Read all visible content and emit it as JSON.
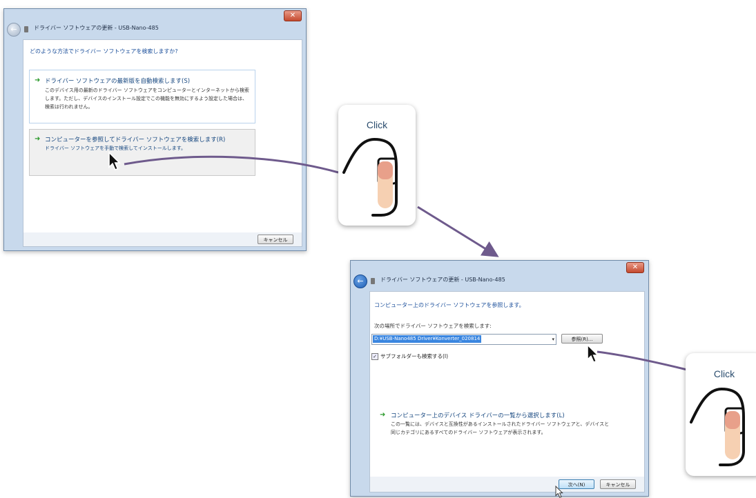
{
  "dialog1": {
    "title": "ドライバー ソフトウェアの更新 - USB-Nano-485",
    "heading": "どのような方法でドライバー ソフトウェアを検索しますか?",
    "option_auto": {
      "title": "ドライバー ソフトウェアの最新版を自動検索します(S)",
      "description": "このデバイス用の最新のドライバー ソフトウェアをコンピューターとインターネットから検索します。ただし、デバイスのインストール設定でこの機能を無効にするよう設定した場合は、検索は行われません。"
    },
    "option_browse": {
      "title": "コンピューターを参照してドライバー ソフトウェアを検索します(R)",
      "description": "ドライバー ソフトウェアを手動で検索してインストールします。"
    },
    "cancel_label": "キャンセル"
  },
  "dialog2": {
    "title": "ドライバー ソフトウェアの更新 - USB-Nano-485",
    "heading": "コンピューター上のドライバー ソフトウェアを参照します。",
    "search_label": "次の場所でドライバー ソフトウェアを検索します:",
    "path_value": "D:¥USB-Nano485 Driver¥Konverter_020814",
    "browse_label": "参照(R)...",
    "subfolder_label": "サブフォルダーも検索する(I)",
    "subfolder_checked": true,
    "pick_option": {
      "title": "コンピューター上のデバイス ドライバーの一覧から選択します(L)",
      "description": "この一覧には、デバイスと互換性があるインストールされたドライバー ソフトウェアと、デバイスと同じカテゴリにあるすべてのドライバー ソフトウェアが表示されます。"
    },
    "next_label": "次へ(N)",
    "cancel_label": "キャンセル"
  },
  "cards": {
    "card1_label": "Click",
    "card2_label": "Click"
  },
  "colors": {
    "connector": "#6e5a8c",
    "link_blue": "#1b4f9b",
    "arrow_green": "#2c9a2c",
    "close_red": "#c44a2f"
  }
}
